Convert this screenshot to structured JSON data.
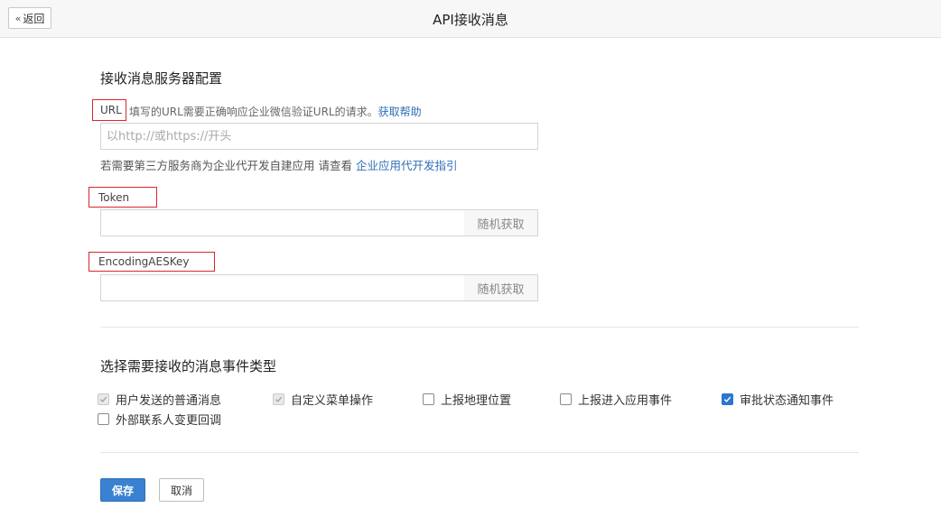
{
  "header": {
    "back_label": "返回",
    "title": "API接收消息"
  },
  "server_config": {
    "section_title": "接收消息服务器配置",
    "url": {
      "label": "URL",
      "hint": "填写的URL需要正确响应企业微信验证URL的请求。",
      "help_link": "获取帮助",
      "value": "",
      "placeholder": "以http://或https://开头",
      "third_party_hint": "若需要第三方服务商为企业代开发自建应用 请查看",
      "third_party_link": "企业应用代开发指引"
    },
    "token": {
      "label": "Token",
      "value": "",
      "random_button": "随机获取"
    },
    "aes_key": {
      "label": "EncodingAESKey",
      "value": "",
      "random_button": "随机获取"
    }
  },
  "events": {
    "section_title": "选择需要接收的消息事件类型",
    "options": [
      {
        "label": "用户发送的普通消息",
        "checked": true,
        "disabled": true
      },
      {
        "label": "自定义菜单操作",
        "checked": true,
        "disabled": true
      },
      {
        "label": "上报地理位置",
        "checked": false,
        "disabled": false
      },
      {
        "label": "上报进入应用事件",
        "checked": false,
        "disabled": false
      },
      {
        "label": "审批状态通知事件",
        "checked": true,
        "disabled": false
      },
      {
        "label": "外部联系人变更回调",
        "checked": false,
        "disabled": false
      }
    ]
  },
  "actions": {
    "save_label": "保存",
    "cancel_label": "取消"
  },
  "colors": {
    "link": "#2f6fb7",
    "primary": "#3a82d1",
    "annotation_box": "#d9262b"
  }
}
